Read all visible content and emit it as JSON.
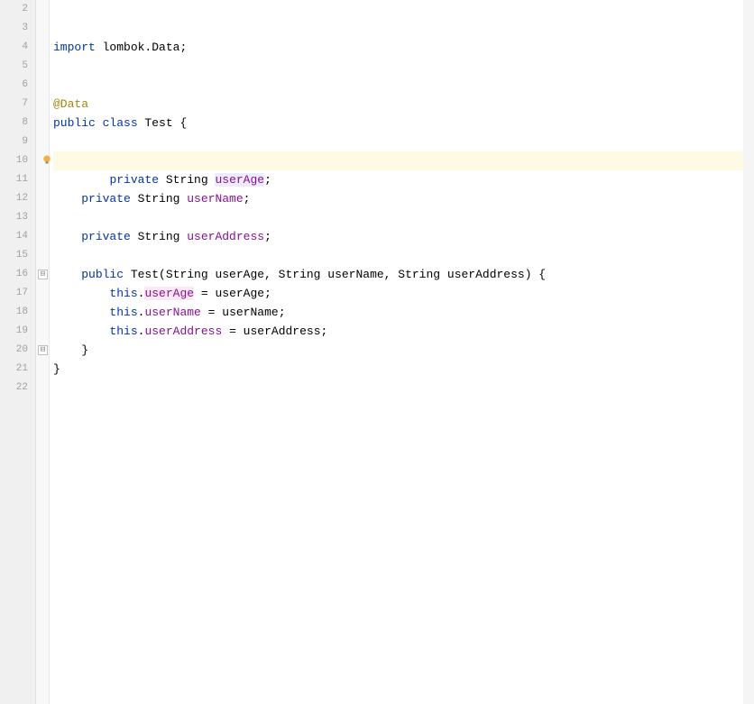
{
  "lines": {
    "start": 2,
    "end": 22
  },
  "code": {
    "l4": {
      "import_kw": "import",
      "pkg": " lombok.",
      "data_cls": "Data",
      "semi": ";"
    },
    "l7": {
      "annotation": "@Data"
    },
    "l8": {
      "public_kw": "public",
      "class_kw": " class",
      "name": " Test ",
      "brace": "{"
    },
    "l10": {
      "indent": "    ",
      "private_kw": "private",
      "type": " String ",
      "field": "userAge",
      "semi": ";"
    },
    "l12": {
      "indent": "    ",
      "private_kw": "private",
      "type": " String ",
      "field": "userName",
      "semi": ";"
    },
    "l14": {
      "indent": "    ",
      "private_kw": "private",
      "type": " String ",
      "field": "userAddress",
      "semi": ";"
    },
    "l16": {
      "indent": "    ",
      "public_kw": "public",
      "ctor": " Test(String userAge, String userName, String userAddress) {"
    },
    "l17": {
      "indent": "        ",
      "this_kw": "this",
      "dot": ".",
      "field": "userAge",
      "assign": " = userAge;"
    },
    "l18": {
      "indent": "        ",
      "this_kw": "this",
      "dot": ".",
      "field": "userName",
      "assign": " = userName;"
    },
    "l19": {
      "indent": "        ",
      "this_kw": "this",
      "dot": ".",
      "field": "userAddress",
      "assign": " = userAddress;"
    },
    "l20": {
      "indent": "    ",
      "brace": "}"
    },
    "l21": {
      "brace": "}"
    }
  },
  "fold_markers": {
    "line16": "⊟",
    "line20": "⊟"
  }
}
